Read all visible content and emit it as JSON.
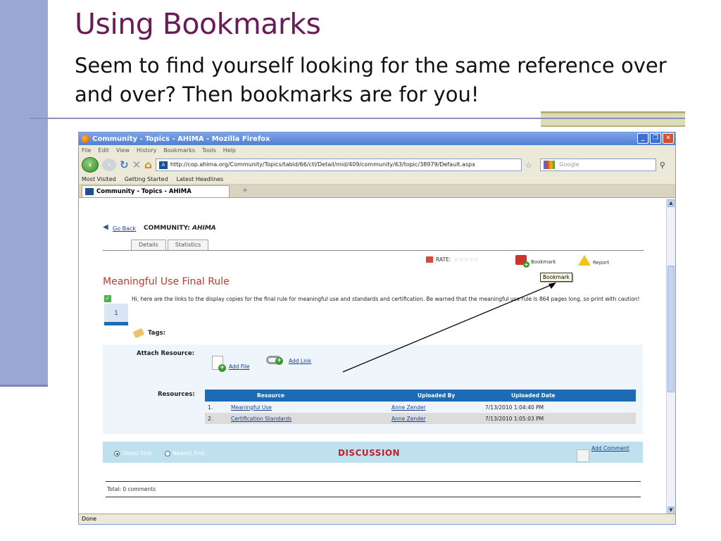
{
  "slide": {
    "title": "Using Bookmarks",
    "subtitle": "Seem to find yourself looking for the same reference over and over?  Then bookmarks are for you!"
  },
  "browser": {
    "window_title": "Community - Topics - AHIMA - Mozilla Firefox",
    "menu": [
      "File",
      "Edit",
      "View",
      "History",
      "Bookmarks",
      "Tools",
      "Help"
    ],
    "url": "http://cop.ahima.org/Community/Topics/tabid/66/ctl/Detail/mid/409/community/63/topic/38979/Default.aspx",
    "search_placeholder": "Google",
    "bookmarks_bar": [
      "Most Visited",
      "Getting Started",
      "Latest Headlines"
    ],
    "tab_label": "Community - Topics - AHIMA",
    "status": "Done"
  },
  "page": {
    "go_back": "Go Back",
    "community_prefix": "COMMUNITY:",
    "community_name": "AHIMA",
    "tabs": [
      "Details",
      "Statistics"
    ],
    "rate_label": "RATE:",
    "stars": "☆☆☆☆☆",
    "bookmark_label": "Bookmark",
    "report_label": "Report",
    "tooltip": "Bookmark",
    "topic_title": "Meaningful Use Final Rule",
    "vote_count": "1",
    "topic_body": "Hi, here are the links to the display copies for the final rule for meaningful use and standards and certification. Be warned that the meaningful use rule is 864 pages long, so print with caution!",
    "tags_label": "Tags:",
    "attach_label": "Attach Resource:",
    "add_file": "Add File",
    "add_link": "Add Link",
    "resources_label": "Resources:",
    "table": {
      "headers": [
        "Resource",
        "Uploaded By",
        "Uploaded Date"
      ],
      "rows": [
        {
          "num": "1.",
          "resource": "Meaningful Use",
          "by": "Anne Zender",
          "date": "7/13/2010 1:04:40 PM"
        },
        {
          "num": "2.",
          "resource": "Certification Standards",
          "by": "Anne Zender",
          "date": "7/13/2010 1:05:03 PM"
        }
      ]
    },
    "sort_oldest": "Oldest First",
    "sort_newest": "Newest First",
    "discussion_title": "DISCUSSION",
    "add_comment": "Add Comment",
    "total_comments": "Total: 0 comments"
  }
}
